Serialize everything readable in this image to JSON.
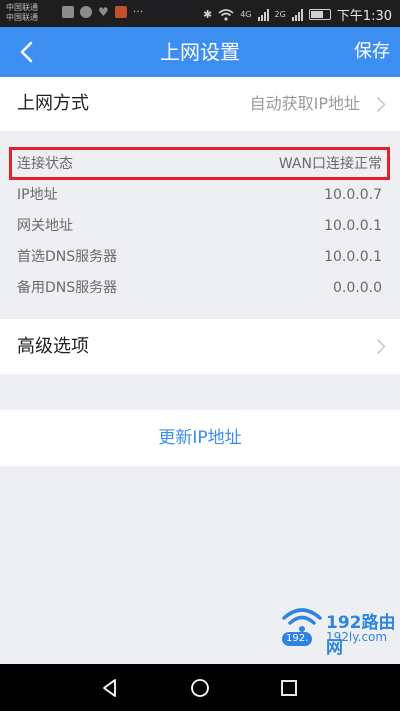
{
  "status_bar": {
    "carrier_1": "中国联通",
    "carrier_2": "中国联通",
    "more_dots": "···",
    "network_4g": "4G",
    "network_2g": "2G",
    "time": "下午1:30",
    "icons": [
      "message-icon",
      "wechat-icon",
      "heart-icon",
      "app-icon",
      "bluetooth-icon",
      "wifi-icon",
      "signal-icon",
      "battery-icon"
    ]
  },
  "header": {
    "title": "上网设置",
    "save_label": "保存",
    "accent_color": "#3c8ef0"
  },
  "access_method": {
    "label": "上网方式",
    "value": "自动获取IP地址"
  },
  "info": [
    {
      "label": "连接状态",
      "value": "WAN口连接正常"
    },
    {
      "label": "IP地址",
      "value": "10.0.0.7"
    },
    {
      "label": "网关地址",
      "value": "10.0.0.1"
    },
    {
      "label": "首选DNS服务器",
      "value": "10.0.0.1"
    },
    {
      "label": "备用DNS服务器",
      "value": "0.0.0.0"
    }
  ],
  "highlight_color": "#e0202a",
  "advanced": {
    "label": "高级选项"
  },
  "renew": {
    "label": "更新IP地址"
  },
  "watermark": {
    "brand": "192路由网",
    "pill": "192.",
    "site": "192ly.com"
  }
}
